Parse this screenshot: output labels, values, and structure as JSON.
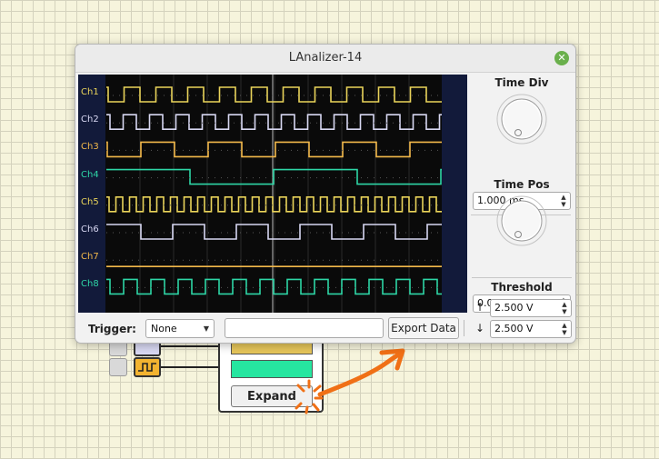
{
  "window": {
    "title": "LAnalizer-14"
  },
  "channels": [
    {
      "label": "Ch1",
      "color": "#ead45a"
    },
    {
      "label": "Ch2",
      "color": "#d8d8f2"
    },
    {
      "label": "Ch3",
      "color": "#f2b84a"
    },
    {
      "label": "Ch4",
      "color": "#2ed6a6"
    },
    {
      "label": "Ch5",
      "color": "#ead45a"
    },
    {
      "label": "Ch6",
      "color": "#d8d8f2"
    },
    {
      "label": "Ch7",
      "color": "#f2b84a"
    },
    {
      "label": "Ch8",
      "color": "#2ed6a6"
    }
  ],
  "controls": {
    "time_div": {
      "label": "Time Div",
      "value": "1.000 ms"
    },
    "time_pos": {
      "label": "Time Pos",
      "value": "0.000 ps"
    },
    "threshold": {
      "label": "Threshold",
      "up_arrow": "↑",
      "down_arrow": "↓",
      "high": "2.500 V",
      "low": "2.500 V"
    }
  },
  "bottom": {
    "trigger_label": "Trigger:",
    "trigger_value": "None",
    "search_value": "",
    "export_label": "Export Data"
  },
  "component": {
    "expand_label": "Expand"
  },
  "colors": {
    "accent_arrow": "#f07016",
    "close": "#6ab04c",
    "bar_yellow": "#e6c65a",
    "bar_green": "#26e6a0"
  }
}
